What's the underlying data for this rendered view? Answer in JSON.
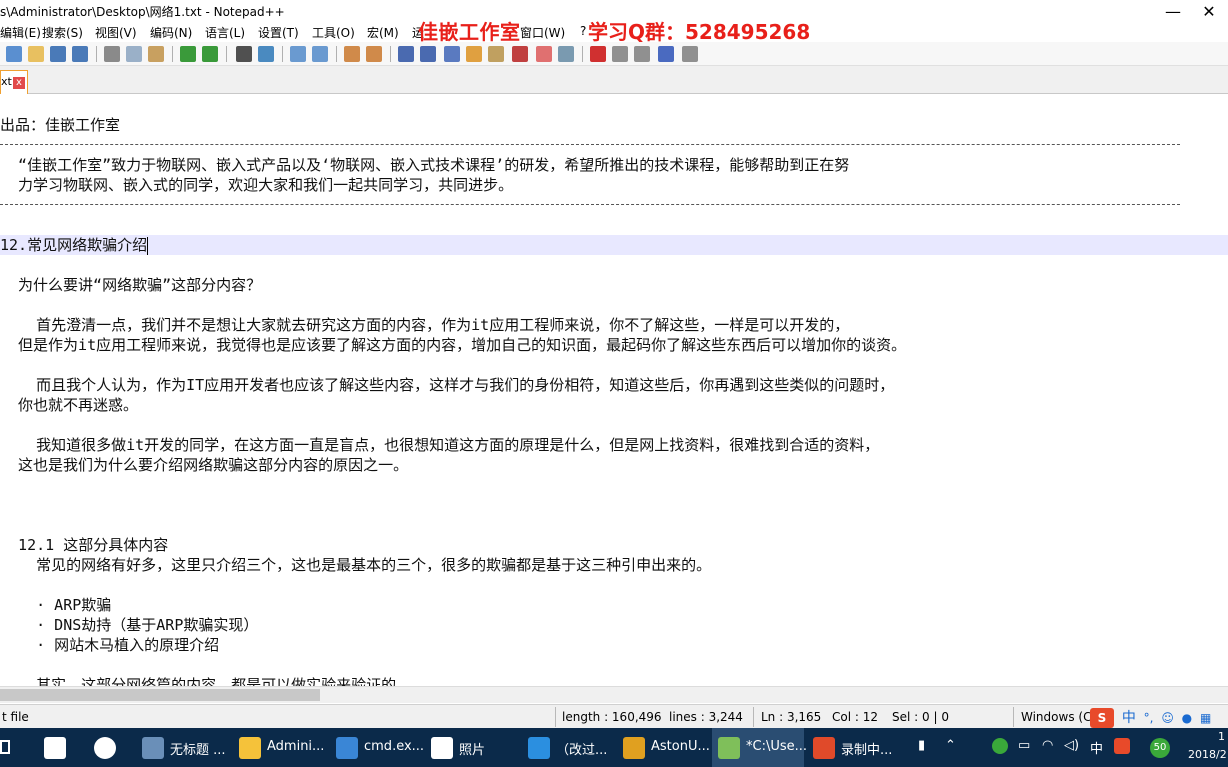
{
  "window": {
    "title": "s\\Administrator\\Desktop\\网络1.txt - Notepad++",
    "watermark_name": "佳嵌工作室",
    "watermark_qq": "学习Q群：528495268",
    "minimize": "—",
    "close": "✕"
  },
  "menu": [
    "编辑(E)",
    "搜索(S)",
    "视图(V)",
    "编码(N)",
    "语言(L)",
    "设置(T)",
    "工具(O)",
    "宏(M)",
    "运",
    "窗口(W)",
    "?"
  ],
  "toolbar_icons": [
    "new-file-icon",
    "open-file-icon",
    "save-icon",
    "save-all-icon",
    "close-icon",
    "close-all-icon",
    "print-icon",
    "cut-icon",
    "copy-icon",
    "paste-icon",
    "undo-icon",
    "redo-icon",
    "find-icon",
    "replace-icon",
    "zoom-in-icon",
    "zoom-out-icon",
    "sync-v-icon",
    "sync-h-icon",
    "wrap-icon",
    "all-chars-icon",
    "indent-guide-icon",
    "udl-icon",
    "doc-map-icon",
    "function-list-icon",
    "folder-workspace-icon",
    "monitor-icon",
    "record-macro-icon",
    "stop-macro-icon",
    "play-macro-icon",
    "run-macro-icon",
    "save-macro-icon"
  ],
  "tab": {
    "label": "xt",
    "close": "x"
  },
  "editor": {
    "lines": [
      "出品：佳嵌工作室",
      "  “佳嵌工作室”致力于物联网、嵌入式产品以及‘物联网、嵌入式技术课程’的研发，希望所推出的技术课程，能够帮助到正在努",
      "  力学习物联网、嵌入式的同学，欢迎大家和我们一起共同学习，共同进步。",
      "12.常见网络欺骗介绍",
      "  为什么要讲“网络欺骗”这部分内容？",
      "    首先澄清一点，我们并不是想让大家就去研究这方面的内容，作为it应用工程师来说，你不了解这些，一样是可以开发的，",
      "  但是作为it应用工程师来说，我觉得也是应该要了解这方面的内容，增加自己的知识面，最起码你了解这些东西后可以增加你的谈资。",
      "    而且我个人认为，作为IT应用开发者也应该了解这些内容，这样才与我们的身份相符，知道这些后，你再遇到这些类似的问题时，",
      "  你也就不再迷惑。",
      "    我知道很多做it开发的同学，在这方面一直是盲点，也很想知道这方面的原理是什么，但是网上找资料，很难找到合适的资料，",
      "  这也是我们为什么要介绍网络欺骗这部分内容的原因之一。",
      "  12.1 这部分具体内容",
      "    常见的网络有好多，这里只介绍三个，这也是最基本的三个，很多的欺骗都是基于这三种引申出来的。",
      "    · ARP欺骗",
      "    · DNS劫持（基于ARP欺骗实现）",
      "    · 网站木马植入的原理介绍",
      "    其实，这部分网络篇的内容，都是可以做实验来验证的"
    ]
  },
  "status": {
    "type": "t file",
    "length": "length : 160,496",
    "lines": "lines : 3,244",
    "ln": "Ln : 3,165",
    "col": "Col : 12",
    "sel": "Sel : 0 | 0",
    "eol": "Windows (C",
    "ime_lang": "中"
  },
  "taskbar": {
    "items": [
      {
        "label": "无标题 ...",
        "color": "#6a8fb8"
      },
      {
        "label": "Admini...",
        "color": "#f5c23a"
      },
      {
        "label": "cmd.ex...",
        "color": "#3a86d6"
      },
      {
        "label": "照片",
        "color": "#ffffff"
      },
      {
        "label": "（改过...",
        "color": "#2b8fe0"
      },
      {
        "label": "AstonU...",
        "color": "#e0a020"
      },
      {
        "label": "*C:\\Use...",
        "color": "#7fbf5a"
      },
      {
        "label": "录制中...",
        "color": "#e04a2a"
      }
    ],
    "tray_lang": "中",
    "date": "2018/2",
    "time": "1",
    "battery_badge": "50"
  }
}
